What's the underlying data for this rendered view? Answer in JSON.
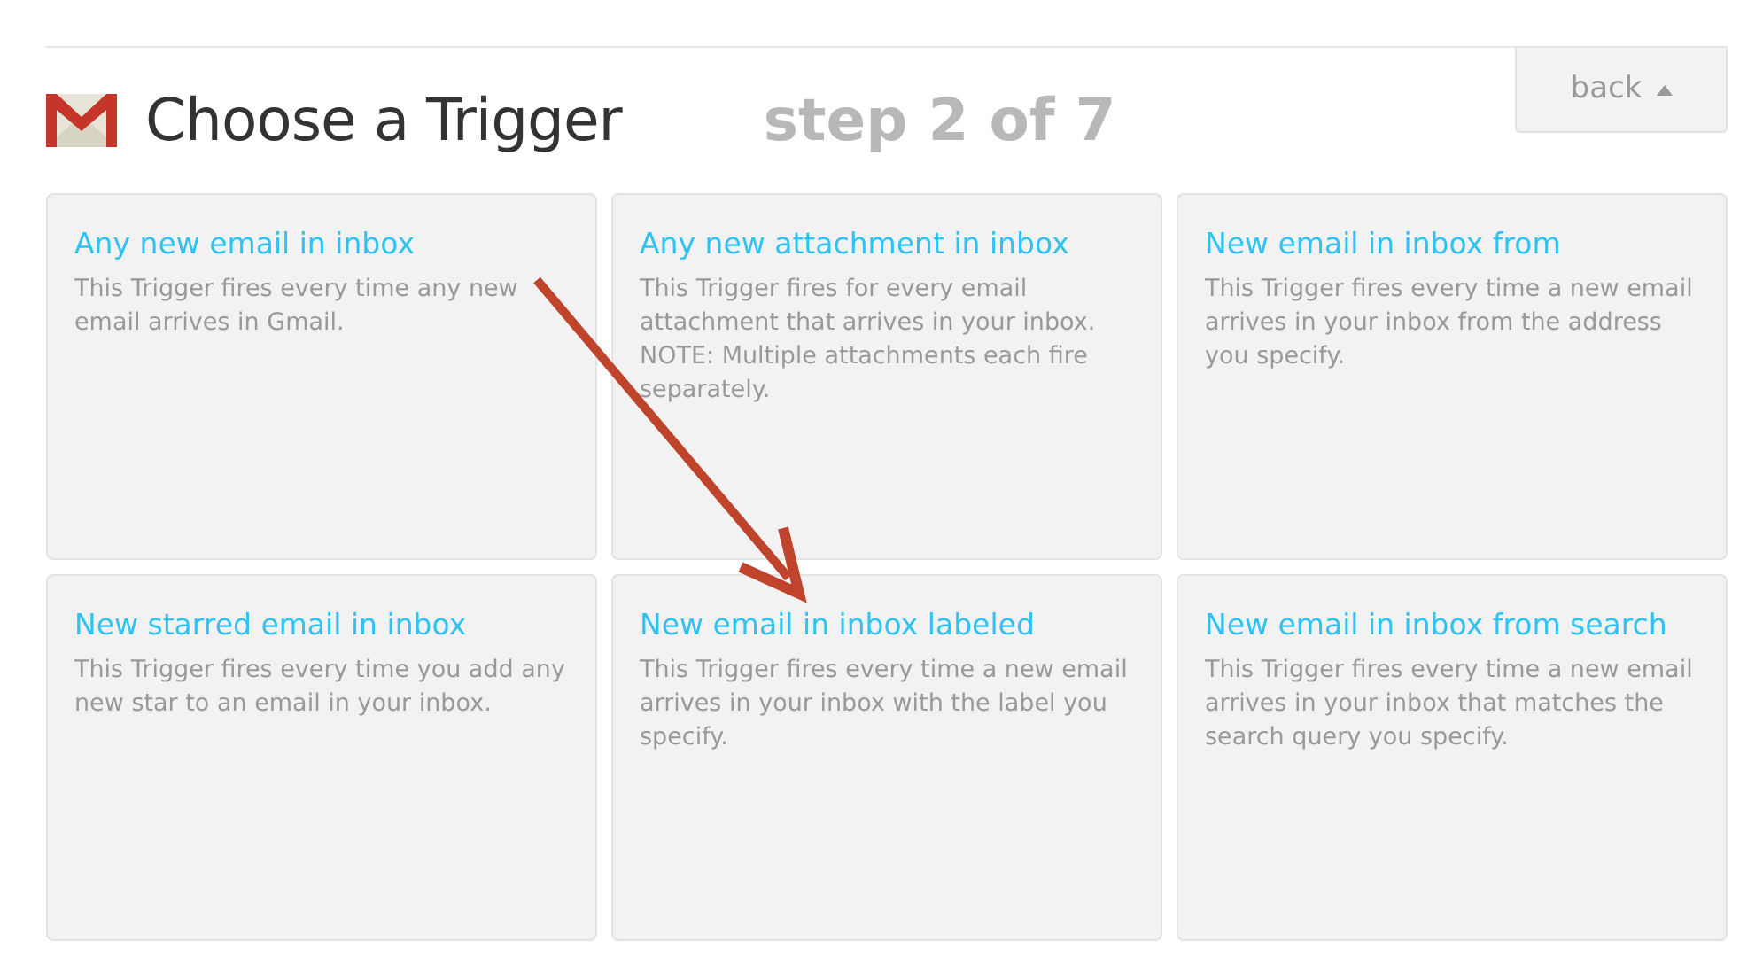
{
  "header": {
    "title": "Choose a Trigger",
    "step": "step 2 of 7",
    "back_button": "back"
  },
  "triggers": [
    {
      "title": "Any new email in inbox",
      "description": "This Trigger fires every time any new email arrives in Gmail."
    },
    {
      "title": "Any new attachment in inbox",
      "description": "This Trigger fires for every email attachment that arrives in your inbox. NOTE: Multiple attachments each fire separately."
    },
    {
      "title": "New email in inbox from",
      "description": "This Trigger fires every time a new email arrives in your inbox from the address you specify."
    },
    {
      "title": "New starred email in inbox",
      "description": "This Trigger fires every time you add any new star to an email in your inbox."
    },
    {
      "title": "New email in inbox labeled",
      "description": "This Trigger fires every time a new email arrives in your inbox with the label you specify."
    },
    {
      "title": "New email in inbox from search",
      "description": "This Trigger fires every time a new email arrives in your inbox that matches the search query you specify."
    }
  ]
}
